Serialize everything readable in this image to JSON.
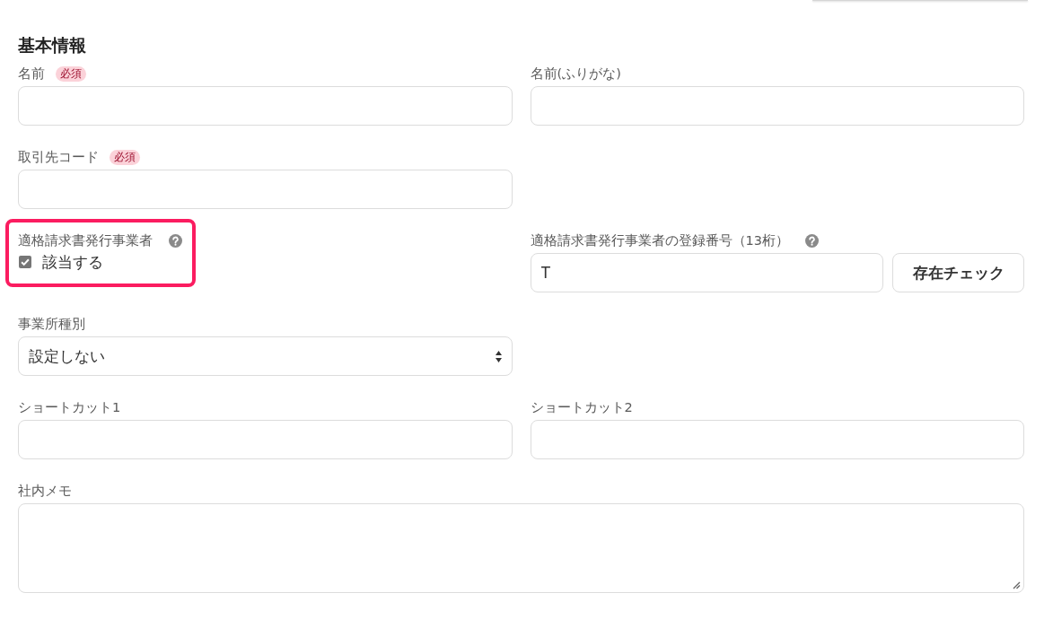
{
  "form": {
    "title": "基本情報",
    "rows": [
      [
        {
          "kind": "text",
          "label": "名前",
          "required_tag": "必須"
        },
        {
          "kind": "text",
          "label": "名前(ふりがな)"
        }
      ],
      [
        {
          "kind": "text",
          "label": "取引先コード",
          "required_tag": "必須"
        }
      ],
      [
        {
          "kind": "checkbox",
          "label": "適格請求書発行事業者",
          "help": true,
          "highlighted": true,
          "option": "該当する",
          "checked": true
        },
        {
          "kind": "text_with_button",
          "label": "適格請求書発行事業者の登録番号（13桁）",
          "help": true,
          "value": "T",
          "button": "存在チェック"
        }
      ],
      [
        {
          "kind": "select",
          "label": "事業所種別",
          "value": "設定しない"
        }
      ],
      [
        {
          "kind": "text",
          "label": "ショートカット1"
        },
        {
          "kind": "text",
          "label": "ショートカット2"
        }
      ],
      [
        {
          "kind": "textarea",
          "label": "社内メモ"
        }
      ]
    ]
  }
}
